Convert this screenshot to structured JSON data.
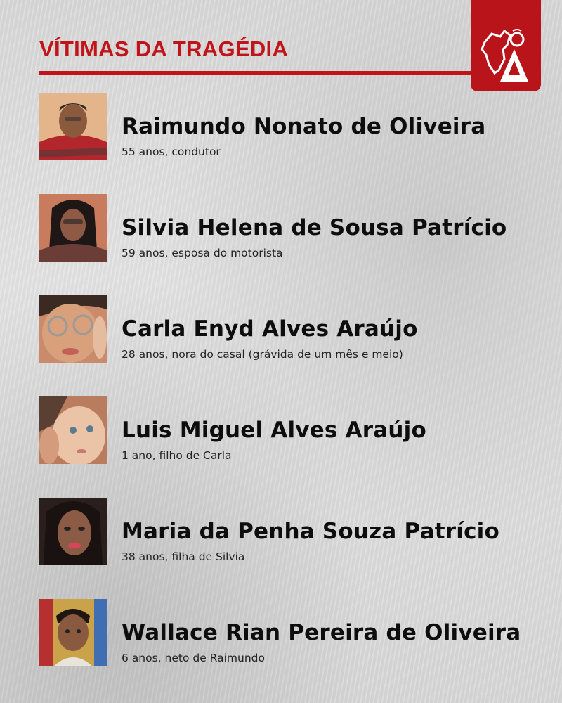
{
  "header": {
    "title": "VÍTIMAS DA TRAGÉDIA",
    "accent_color": "#c0141a",
    "logo_icon": "map-letter-a-logo"
  },
  "victims": [
    {
      "name": "Raimundo Nonato de Oliveira",
      "description": "55 anos, condutor"
    },
    {
      "name": "Silvia Helena de Sousa Patrício",
      "description": "59 anos, esposa do motorista"
    },
    {
      "name": "Carla Enyd Alves Araújo",
      "description": "28 anos, nora do casal (grávida de um mês e meio)"
    },
    {
      "name": "Luis Miguel Alves Araújo",
      "description": "1 ano, filho de Carla"
    },
    {
      "name": "Maria da Penha Souza Patrício",
      "description": "38 anos, filha de Silvia"
    },
    {
      "name": "Wallace Rian Pereira de Oliveira",
      "description": "6 anos, neto de Raimundo"
    }
  ]
}
